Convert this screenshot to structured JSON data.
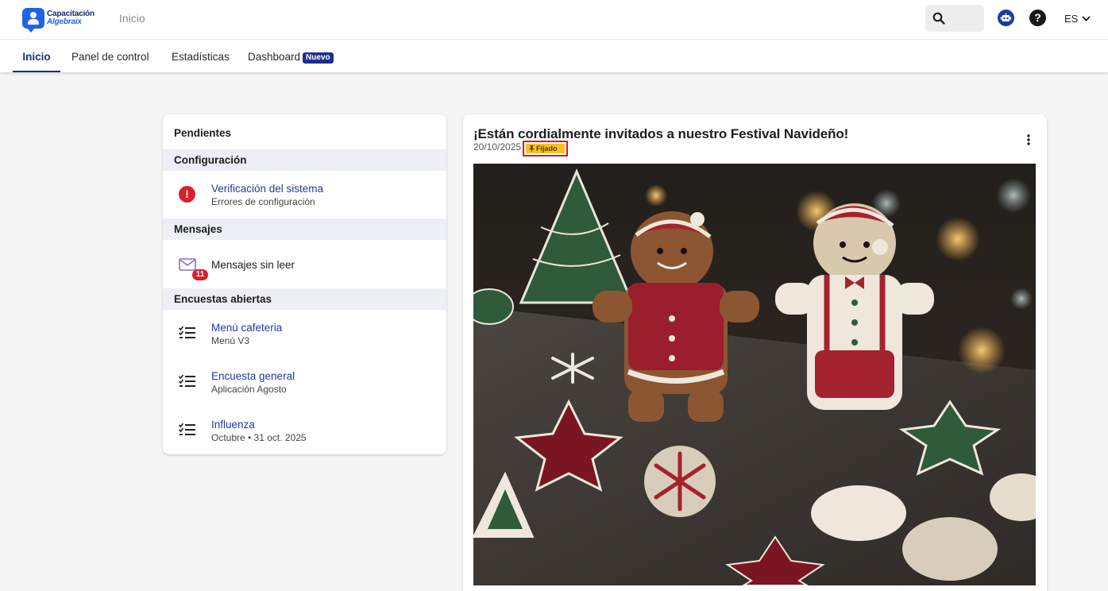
{
  "app": {
    "logo_line1": "Capacitación",
    "logo_line2": "Algebraix",
    "breadcrumb": "Inicio",
    "language": "ES",
    "help_label": "?"
  },
  "tabs": [
    {
      "label": "Inicio",
      "active": true
    },
    {
      "label": "Panel de control",
      "active": false
    },
    {
      "label": "Estadísticas",
      "active": false
    },
    {
      "label": "Dashboard",
      "active": false,
      "badge": "Nuevo"
    }
  ],
  "pending": {
    "title": "Pendientes",
    "sections": [
      {
        "title": "Configuración",
        "items": [
          {
            "title": "Verificación del sistema",
            "subtitle": "Errores de configuración",
            "icon": "error-icon"
          }
        ]
      },
      {
        "title": "Mensajes",
        "items": [
          {
            "title": "Mensajes sin leer",
            "count": "11",
            "icon": "mail-icon"
          }
        ]
      },
      {
        "title": "Encuestas abiertas",
        "items": [
          {
            "title": "Menú cafeteria",
            "subtitle": "Menú V3",
            "icon": "checklist-icon"
          },
          {
            "title": "Encuesta general",
            "subtitle": "Aplicación Agosto",
            "icon": "checklist-icon"
          },
          {
            "title": "Influenza",
            "subtitle": "Octubre • 31 oct. 2025",
            "icon": "checklist-icon"
          }
        ]
      }
    ]
  },
  "post": {
    "title": "¡Están cordialmente invitados a nuestro Festival Navideño!",
    "date": "20/10/2025",
    "pinned_label": "Fijado",
    "image": "photo"
  },
  "colors": {
    "brand": "#1f63e6",
    "nav_active": "#1e2f7a",
    "link": "#1e3a9a",
    "section_bg": "#eeeef7",
    "error": "#d9212c",
    "pinned": "#f7c21a"
  }
}
